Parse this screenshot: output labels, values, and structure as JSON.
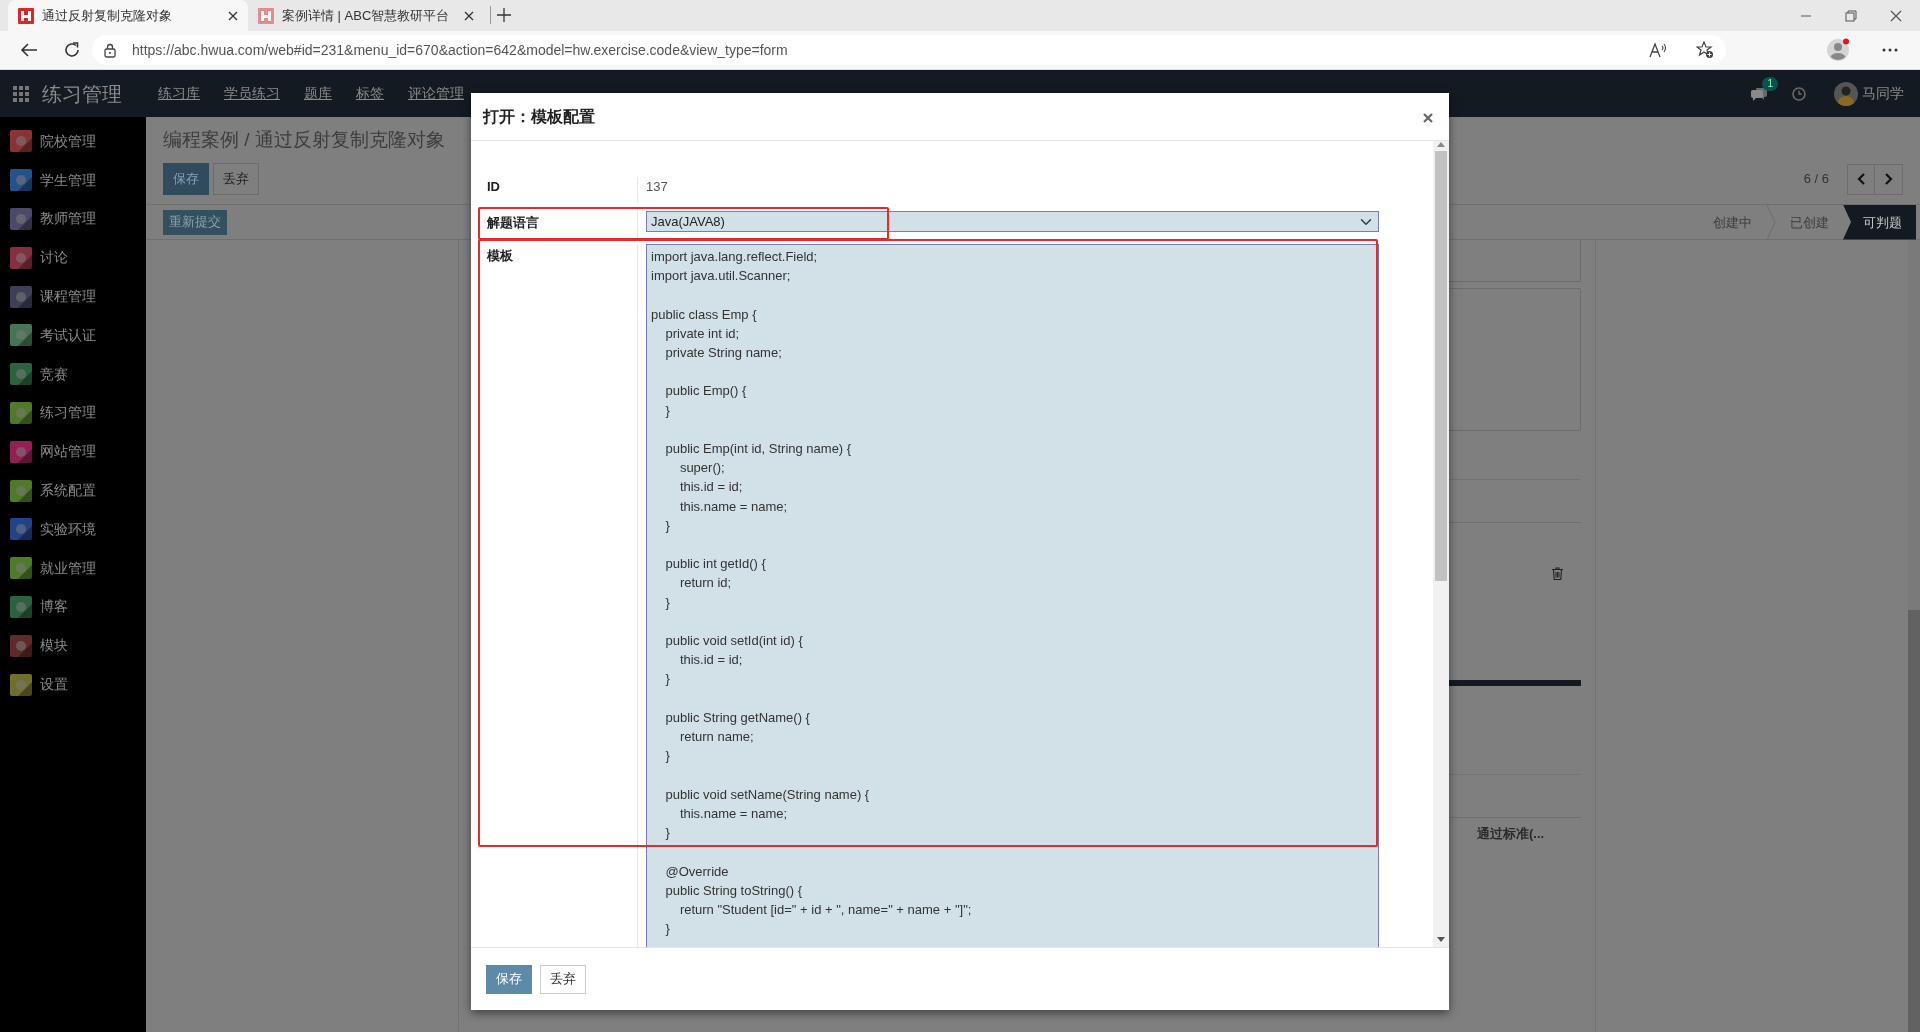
{
  "browser": {
    "tabs": [
      {
        "title": "通过反射复制克隆对象",
        "selected": true
      },
      {
        "title": "案例详情 | ABC智慧教研平台",
        "selected": false
      }
    ],
    "url": "https://abc.hwua.com/web#id=231&menu_id=670&action=642&model=hw.exercise.code&view_type=form"
  },
  "navbar": {
    "brand": "练习管理",
    "menu": [
      "练习库",
      "学员练习",
      "题库",
      "标签",
      "评论管理"
    ],
    "chat_badge": "1",
    "user": "马同学"
  },
  "sidebar": {
    "items": [
      {
        "label": "院校管理",
        "color": "#8a3434"
      },
      {
        "label": "学生管理",
        "color": "#24528a"
      },
      {
        "label": "教师管理",
        "color": "#4c4a6a"
      },
      {
        "label": "讨论",
        "color": "#86303f"
      },
      {
        "label": "课程管理",
        "color": "#3e4058"
      },
      {
        "label": "考试认证",
        "color": "#447556"
      },
      {
        "label": "竞赛",
        "color": "#2d6240"
      },
      {
        "label": "练习管理",
        "color": "#4f7a2a"
      },
      {
        "label": "网站管理",
        "color": "#922052"
      },
      {
        "label": "系统配置",
        "color": "#4f7a2a"
      },
      {
        "label": "实验环境",
        "color": "#22438a"
      },
      {
        "label": "就业管理",
        "color": "#4f7a2a"
      },
      {
        "label": "博客",
        "color": "#2d6240"
      },
      {
        "label": "模块",
        "color": "#5e2a2a"
      },
      {
        "label": "设置",
        "color": "#726e2c"
      }
    ]
  },
  "page": {
    "breadcrumb": "编程案例 / 通过反射复制克隆对象",
    "buttons": [
      {
        "label": "保存",
        "kind": "primary"
      },
      {
        "label": "丢弃",
        "kind": "secondary"
      }
    ],
    "action_button": "重新提交",
    "pager": "6 / 6",
    "stages": [
      {
        "label": "创建中",
        "selected": false
      },
      {
        "label": "已创建",
        "selected": false
      },
      {
        "label": "可判题",
        "selected": true
      }
    ],
    "sheet_text": "通过标准(..."
  },
  "dialog": {
    "title": "打开：模板配置",
    "fields": [
      {
        "kind": "text",
        "label": "ID",
        "value": "137",
        "highlighted": false
      },
      {
        "kind": "select",
        "label": "解题语言",
        "value": "Java(JAVA8)",
        "highlighted": true
      },
      {
        "kind": "code",
        "label": "模板",
        "value": "import java.lang.reflect.Field;\nimport java.util.Scanner;\n\npublic class Emp {\n    private int id;\n    private String name;\n\n    public Emp() {\n    }\n\n    public Emp(int id, String name) {\n        super();\n        this.id = id;\n        this.name = name;\n    }\n\n    public int getId() {\n        return id;\n    }\n\n    public void setId(int id) {\n        this.id = id;\n    }\n\n    public String getName() {\n        return name;\n    }\n\n    public void setName(String name) {\n        this.name = name;\n    }\n\n    @Override\n    public String toString() {\n        return \"Student [id=\" + id + \", name=\" + name + \"]\";\n    }",
        "highlighted": true
      }
    ],
    "buttons": [
      {
        "label": "保存",
        "kind": "primary"
      },
      {
        "label": "丢弃",
        "kind": "secondary"
      }
    ]
  }
}
